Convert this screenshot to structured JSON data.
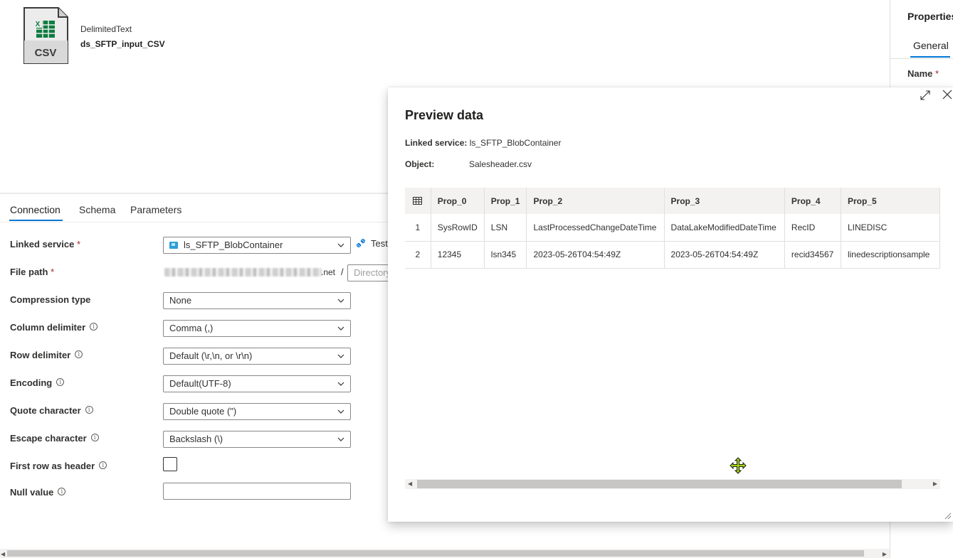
{
  "dataset": {
    "icon": "csv-file-icon",
    "icon_text": "CSV",
    "type": "DelimitedText",
    "name": "ds_SFTP_input_CSV"
  },
  "properties_panel": {
    "title": "Properties",
    "tab": "General",
    "name_label": "Name",
    "required_mark": "*"
  },
  "tabs": {
    "connection": "Connection",
    "schema": "Schema",
    "parameters": "Parameters",
    "active": "Connection"
  },
  "form": {
    "linked_service_label": "Linked service",
    "linked_service_value": "ls_SFTP_BlobContainer",
    "test_connection": "Test",
    "file_path_label": "File path",
    "file_path_suffix": ".net",
    "file_path_separator": "/",
    "directory_placeholder": "Directory",
    "compression_label": "Compression type",
    "compression_value": "None",
    "column_delim_label": "Column delimiter",
    "column_delim_value": "Comma (,)",
    "row_delim_label": "Row delimiter",
    "row_delim_value": "Default (\\r,\\n, or \\r\\n)",
    "encoding_label": "Encoding",
    "encoding_value": "Default(UTF-8)",
    "quote_label": "Quote character",
    "quote_value": "Double quote (\")",
    "escape_label": "Escape character",
    "escape_value": "Backslash (\\)",
    "first_row_header_label": "First row as header",
    "first_row_header_checked": false,
    "null_value_label": "Null value",
    "null_value": "",
    "required_mark": "*",
    "info_glyph": "i"
  },
  "preview": {
    "title": "Preview data",
    "linked_service_label": "Linked service:",
    "linked_service_value": "ls_SFTP_BlobContainer",
    "object_label": "Object:",
    "object_value": "Salesheader.csv",
    "columns": [
      "Prop_0",
      "Prop_1",
      "Prop_2",
      "Prop_3",
      "Prop_4",
      "Prop_5"
    ],
    "rows": [
      {
        "index": "1",
        "cells": [
          "SysRowID",
          "LSN",
          "LastProcessedChangeDateTime",
          "DataLakeModifiedDateTime",
          "RecID",
          "LINEDISC"
        ]
      },
      {
        "index": "2",
        "cells": [
          "12345",
          "lsn345",
          "2023-05-26T04:54:49Z",
          "2023-05-26T04:54:49Z",
          "recid34567",
          "linedescriptionsample"
        ]
      }
    ]
  },
  "colors": {
    "accent": "#0078d4",
    "required": "#a4262c",
    "border": "#8a8886",
    "header_bg": "#f3f2f1"
  }
}
